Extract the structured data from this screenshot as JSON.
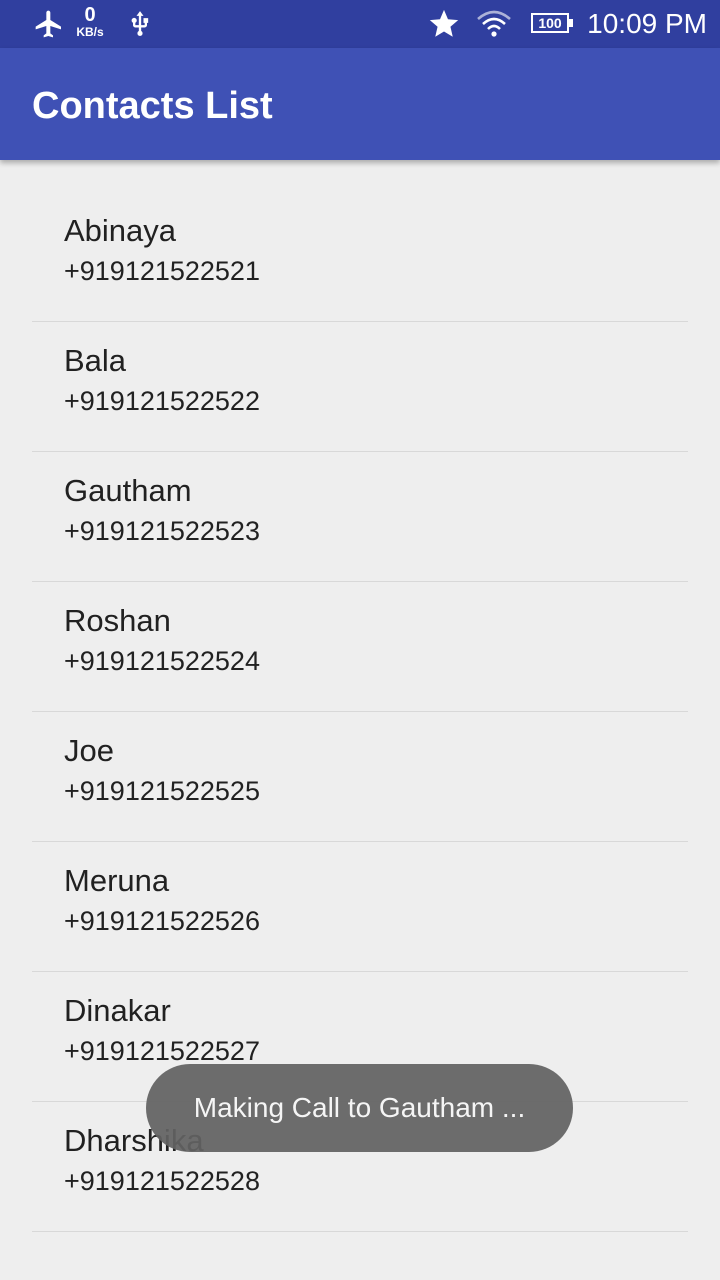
{
  "status_bar": {
    "icons": [
      "airplane-mode-icon",
      "usb-icon",
      "star-icon",
      "wifi-icon",
      "battery-icon"
    ],
    "network_speed_value": "0",
    "network_speed_unit": "KB/s",
    "battery_level": "100",
    "time": "10:09 PM"
  },
  "app_bar": {
    "title": "Contacts List"
  },
  "contacts": [
    {
      "name": "Abinaya",
      "phone": "+919121522521"
    },
    {
      "name": "Bala",
      "phone": "+919121522522"
    },
    {
      "name": "Gautham",
      "phone": "+919121522523"
    },
    {
      "name": "Roshan",
      "phone": "+919121522524"
    },
    {
      "name": "Joe",
      "phone": "+919121522525"
    },
    {
      "name": "Meruna",
      "phone": "+919121522526"
    },
    {
      "name": "Dinakar",
      "phone": "+919121522527"
    },
    {
      "name": "Dharshika",
      "phone": "+919121522528"
    }
  ],
  "toast": {
    "message": "Making Call to Gautham ..."
  },
  "colors": {
    "status_bar": "#303f9f",
    "app_bar": "#3f51b5",
    "background": "#eeeeee",
    "toast": "#626262"
  }
}
